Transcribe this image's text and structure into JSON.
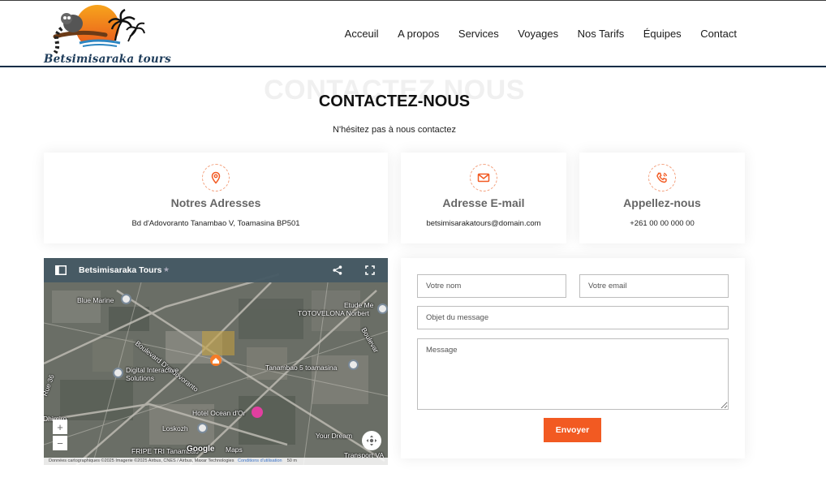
{
  "brand": {
    "name": "Betsimisaraka tours"
  },
  "nav": {
    "items": [
      "Acceuil",
      "A propos",
      "Services",
      "Voyages",
      "Nos Tarifs",
      "Équipes",
      "Contact"
    ]
  },
  "heading": {
    "ghost": "CONTACTEZ NOUS",
    "title": "CONTACTEZ-NOUS",
    "subtitle": "N'hésitez pas à nous contactez"
  },
  "cards": [
    {
      "icon": "location-pin-icon",
      "title": "Notres Adresses",
      "value": "Bd d'Adovoranto Tanambao V, Toamasina BP501"
    },
    {
      "icon": "envelope-icon",
      "title": "Adresse E-mail",
      "value": "betsimisarakatours@domain.com"
    },
    {
      "icon": "phone-icon",
      "title": "Appellez-nous",
      "value": "+261 00 00 000 00"
    }
  ],
  "map": {
    "title": "Betsimisaraka Tours",
    "labels": {
      "blue_marine": "Blue Marine",
      "boulevard": "Boulevard D'andovoranto",
      "etude": "Etude Me",
      "totovelona": "TOTOVELONA Norbert",
      "boulevard_right": "Boulevar",
      "digital": "Digital Interactive Solutions",
      "tanambao": "Tanambao 5 toamasina",
      "rue": "Rue 36",
      "hotel": "Hotel Ocean d'Or",
      "loskozh": "Loskozh",
      "your_dream": "Your Dream",
      "fripe": "FRIPE TRI Tanambao",
      "transport": "Transport VA",
      "google": "Google",
      "maps": "Maps",
      "deep": "Dhimiro"
    },
    "footer": "Données cartographiques ©2025 Imagerie ©2025 Airbus, CNES / Airbus, Maxar Technologies",
    "footer_link": "Conditions d'utilisation",
    "scale": "50 m",
    "zoom_in": "+",
    "zoom_out": "−"
  },
  "form": {
    "name_placeholder": "Votre nom",
    "email_placeholder": "Votre email",
    "subject_placeholder": "Objet du message",
    "message_placeholder": "Message",
    "submit_label": "Envoyer"
  },
  "colors": {
    "accent": "#f25a22",
    "navy": "#0f2d46",
    "map_bar": "#465a64"
  }
}
